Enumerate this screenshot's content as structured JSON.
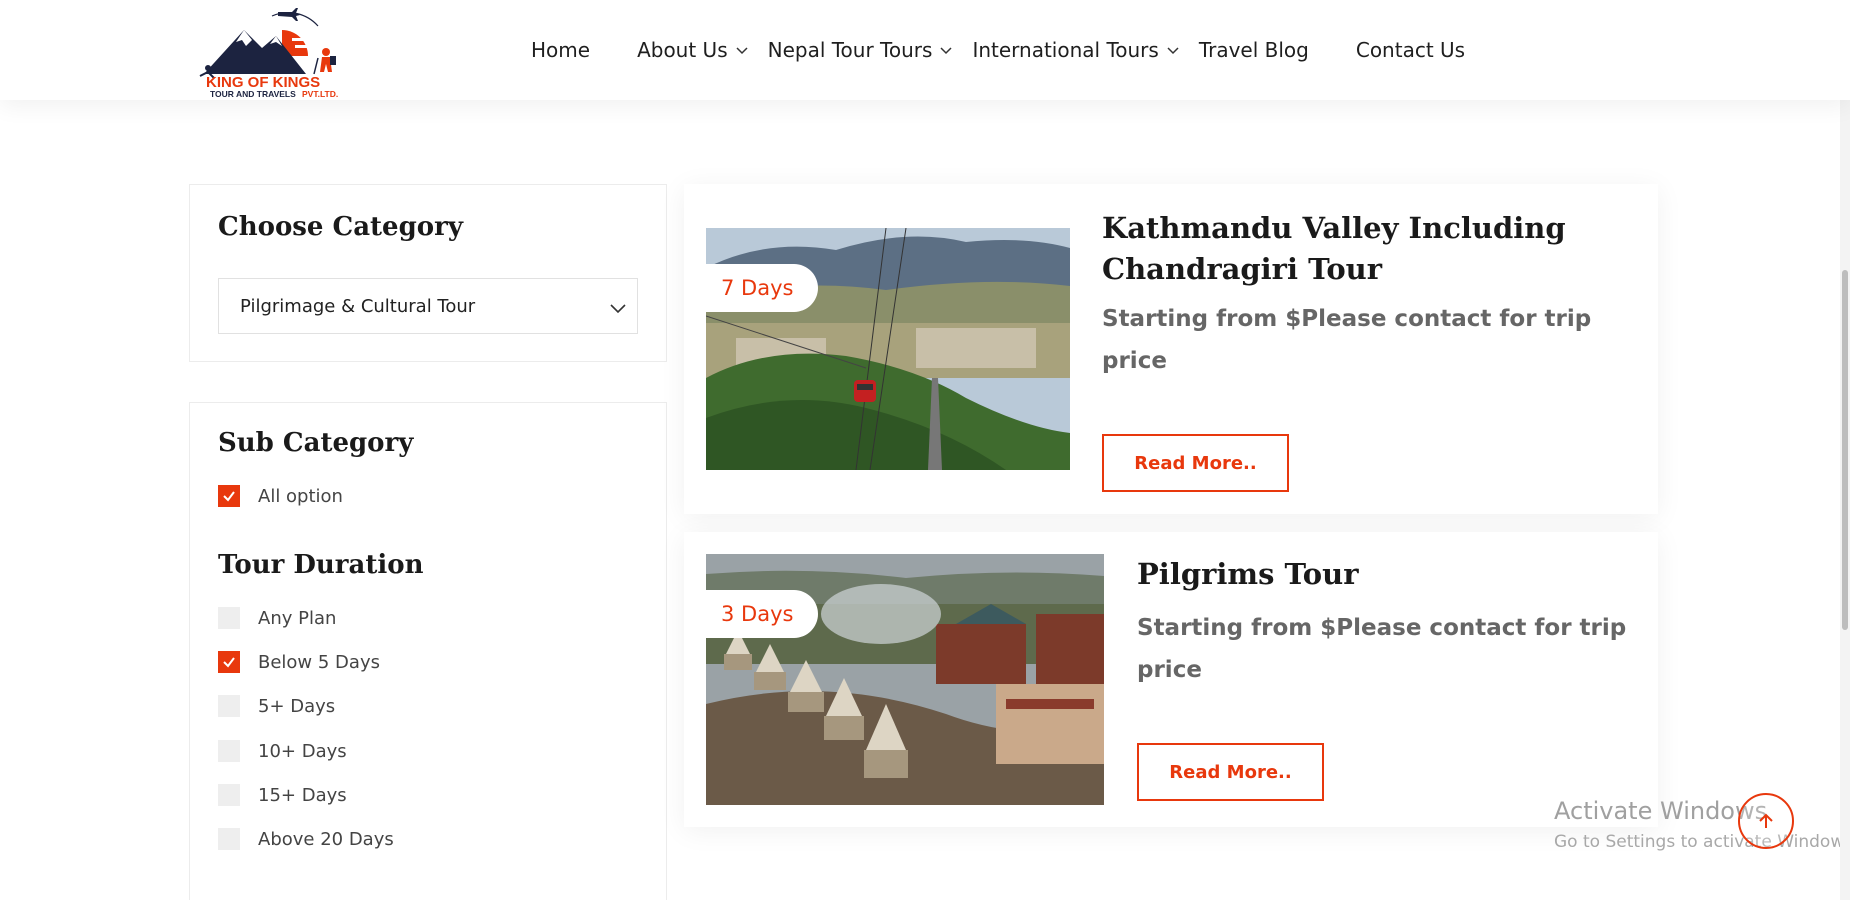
{
  "header": {
    "logo": {
      "line1": "KING OF KINGS",
      "line2": "TOUR AND TRAVELS",
      "line3": "PVT.LTD."
    },
    "nav": [
      {
        "label": "Home",
        "has_dropdown": false
      },
      {
        "label": "About Us",
        "has_dropdown": true
      },
      {
        "label": "Nepal Tour Tours",
        "has_dropdown": true
      },
      {
        "label": "International Tours",
        "has_dropdown": true
      },
      {
        "label": "Travel Blog",
        "has_dropdown": false
      },
      {
        "label": "Contact Us",
        "has_dropdown": false
      }
    ]
  },
  "sidebar": {
    "category": {
      "title": "Choose Category",
      "selected": "Pilgrimage & Cultural Tour",
      "icon": "chevron-down-icon"
    },
    "sub_category": {
      "title": "Sub Category",
      "options": [
        {
          "label": "All option",
          "checked": true
        }
      ]
    },
    "duration": {
      "title": "Tour Duration",
      "options": [
        {
          "label": "Any Plan",
          "checked": false
        },
        {
          "label": "Below 5 Days",
          "checked": true
        },
        {
          "label": "5+ Days",
          "checked": false
        },
        {
          "label": "10+ Days",
          "checked": false
        },
        {
          "label": "15+ Days",
          "checked": false
        },
        {
          "label": "Above 20 Days",
          "checked": false
        }
      ]
    }
  },
  "tours": [
    {
      "days": "7 Days",
      "title": "Kathmandu Valley Including Chandragiri Tour",
      "price": "Starting from $Please contact for trip price",
      "button": "Read More..",
      "image": "cable-car-over-valley"
    },
    {
      "days": "3 Days",
      "title": "Pilgrims Tour",
      "price": "Starting from $Please contact for trip price",
      "button": "Read More..",
      "image": "pashupatinath-temple"
    }
  ],
  "watermark": {
    "title": "Activate Windows",
    "subtitle": "Go to Settings to activate Windows."
  },
  "colors": {
    "accent": "#e8380d",
    "text_dark": "#1a1a1a",
    "text_muted": "#666666",
    "checkbox_off": "#eeeeee"
  },
  "icons": {
    "scroll_top": "arrow-up-icon",
    "check": "check-icon"
  }
}
